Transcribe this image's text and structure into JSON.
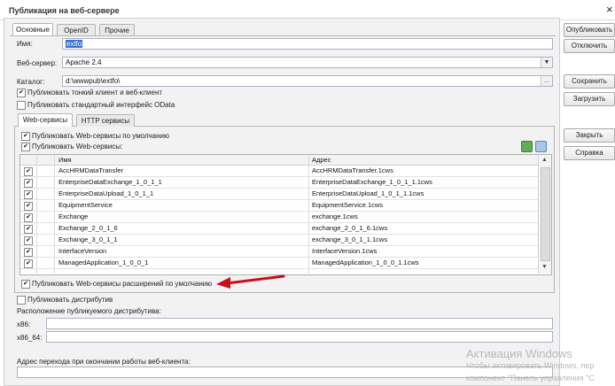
{
  "window": {
    "title": "Публикация на веб-сервере"
  },
  "main_tabs": [
    "Основные",
    "OpenID",
    "Прочие"
  ],
  "right_buttons": [
    "Опубликовать",
    "Отключить",
    "Сохранить",
    "Загрузить",
    "Закрыть",
    "Справка"
  ],
  "form": {
    "name_label": "Имя:",
    "name_value": "extfo",
    "server_label": "Веб-сервер:",
    "server_value": "Apache 2.4",
    "catalog_label": "Каталог:",
    "catalog_value": "d:\\wwwpub\\extfo\\",
    "catalog_button": "...",
    "publish_thin": "Публиковать тонкий клиент и веб-клиент",
    "publish_odata": "Публиковать стандартный интерфейс OData"
  },
  "sub_tabs": [
    "Web-сервисы",
    "HTTP сервисы"
  ],
  "ws": {
    "default_cb": "Публиковать Web-сервисы по умолчанию",
    "publish_cb": "Публиковать Web-сервисы:",
    "col_name": "Имя",
    "col_address": "Адрес",
    "rows": [
      {
        "name": "AccHRMDataTransfer",
        "address": "AccHRMDataTransfer.1cws"
      },
      {
        "name": "EnterpriseDataExchange_1_0_1_1",
        "address": "EnterpriseDataExchange_1_0_1_1.1cws"
      },
      {
        "name": "EnterpriseDataUpload_1_0_1_1",
        "address": "EnterpriseDataUpload_1_0_1_1.1cws"
      },
      {
        "name": "EquipmentService",
        "address": "EquipmentService.1cws"
      },
      {
        "name": "Exchange",
        "address": "exchange.1cws"
      },
      {
        "name": "Exchange_2_0_1_6",
        "address": "exchange_2_0_1_6.1cws"
      },
      {
        "name": "Exchange_3_0_1_1",
        "address": "exchange_3_0_1_1.1cws"
      },
      {
        "name": "InterfaceVersion",
        "address": "InterfaceVersion.1cws"
      },
      {
        "name": "ManagedApplication_1_0_0_1",
        "address": "ManagedApplication_1_0_0_1.1cws"
      }
    ],
    "ext_cb": "Публиковать Web-сервисы расширений по умолчанию"
  },
  "distrib": {
    "cb": "Публиковать дистрибутив",
    "location_label": "Расположение публикуемого дистрибутива:",
    "x86_label": "x86:",
    "x64_label": "x86_64:"
  },
  "redirect_label": "Адрес перехода при окончании работы веб-клиента:",
  "watermark": {
    "line1": "Активация Windows",
    "line2": "Чтобы активировать Windows, пер",
    "line3": "компонент \"Панель управления \"С"
  },
  "colors": {
    "arrow": "#c8101a",
    "field_border": "#aab4c2"
  }
}
